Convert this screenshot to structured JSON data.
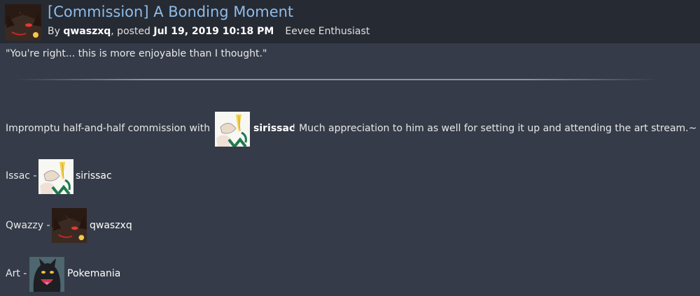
{
  "submission": {
    "title": "[Commission] A Bonding Moment",
    "by_label": "By ",
    "author": "qwaszxq",
    "posted_label": ", posted ",
    "posted_date": "Jul 19, 2019 10:18 PM",
    "user_title": "Eevee Enthusiast"
  },
  "description": {
    "quote": "\"You're right... this is more enjoyable than I thought.\"",
    "commission_prefix": "Impromptu half-and-half commission with",
    "commission_user": "sirissac",
    "commission_suffix": "! Much appreciation to him as well for setting it up and attending the art stream.~",
    "credits": [
      {
        "label": "Issac -",
        "user": "sirissac"
      },
      {
        "label": "Qwazzy -",
        "user": "qwaszxq"
      },
      {
        "label": "Art -",
        "user": "Pokemania"
      }
    ]
  },
  "colors": {
    "background": "#353b48",
    "header_background": "#262a33",
    "title_link": "#8fbce8"
  },
  "icons": {
    "author_avatar": "umbreon-avatar-icon",
    "sirissac_avatar": "sirissac-avatar-icon",
    "pokemania_avatar": "pokemania-avatar-icon"
  }
}
